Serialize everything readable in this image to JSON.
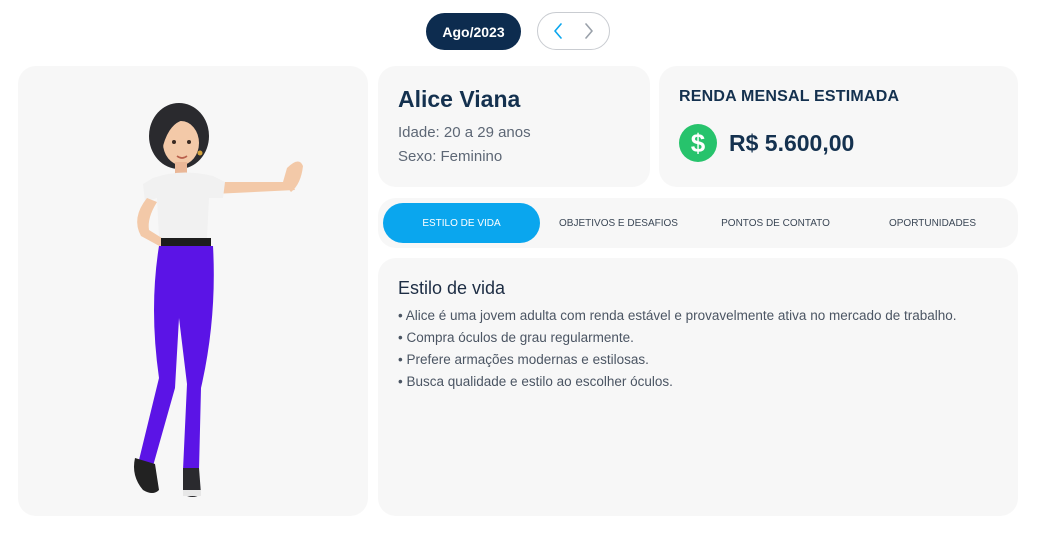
{
  "header": {
    "period": "Ago/2023",
    "prev_icon": "chevron-left-icon",
    "next_icon": "chevron-right-icon"
  },
  "profile": {
    "name": "Alice Viana",
    "age": "Idade: 20 a 29 anos",
    "sex": "Sexo: Feminino"
  },
  "income": {
    "title": "RENDA MENSAL ESTIMADA",
    "icon": "dollar-icon",
    "value": "R$ 5.600,00",
    "icon_color": "#27c36c"
  },
  "tabs": [
    {
      "label": "ESTILO DE VIDA",
      "active": true
    },
    {
      "label": "OBJETIVOS E DESAFIOS",
      "active": false
    },
    {
      "label": "PONTOS DE CONTATO",
      "active": false
    },
    {
      "label": "OPORTUNIDADES",
      "active": false
    }
  ],
  "content": {
    "title": "Estilo de vida",
    "bullets": [
      "• Alice é uma jovem adulta com renda estável e provavelmente ativa no mercado de trabalho.",
      "• Compra óculos de grau regularmente.",
      "• Prefere armações modernas e estilosas.",
      "• Busca qualidade e estilo ao escolher óculos."
    ]
  },
  "colors": {
    "accent": "#0aa6ee",
    "navy": "#0d2c4f"
  }
}
